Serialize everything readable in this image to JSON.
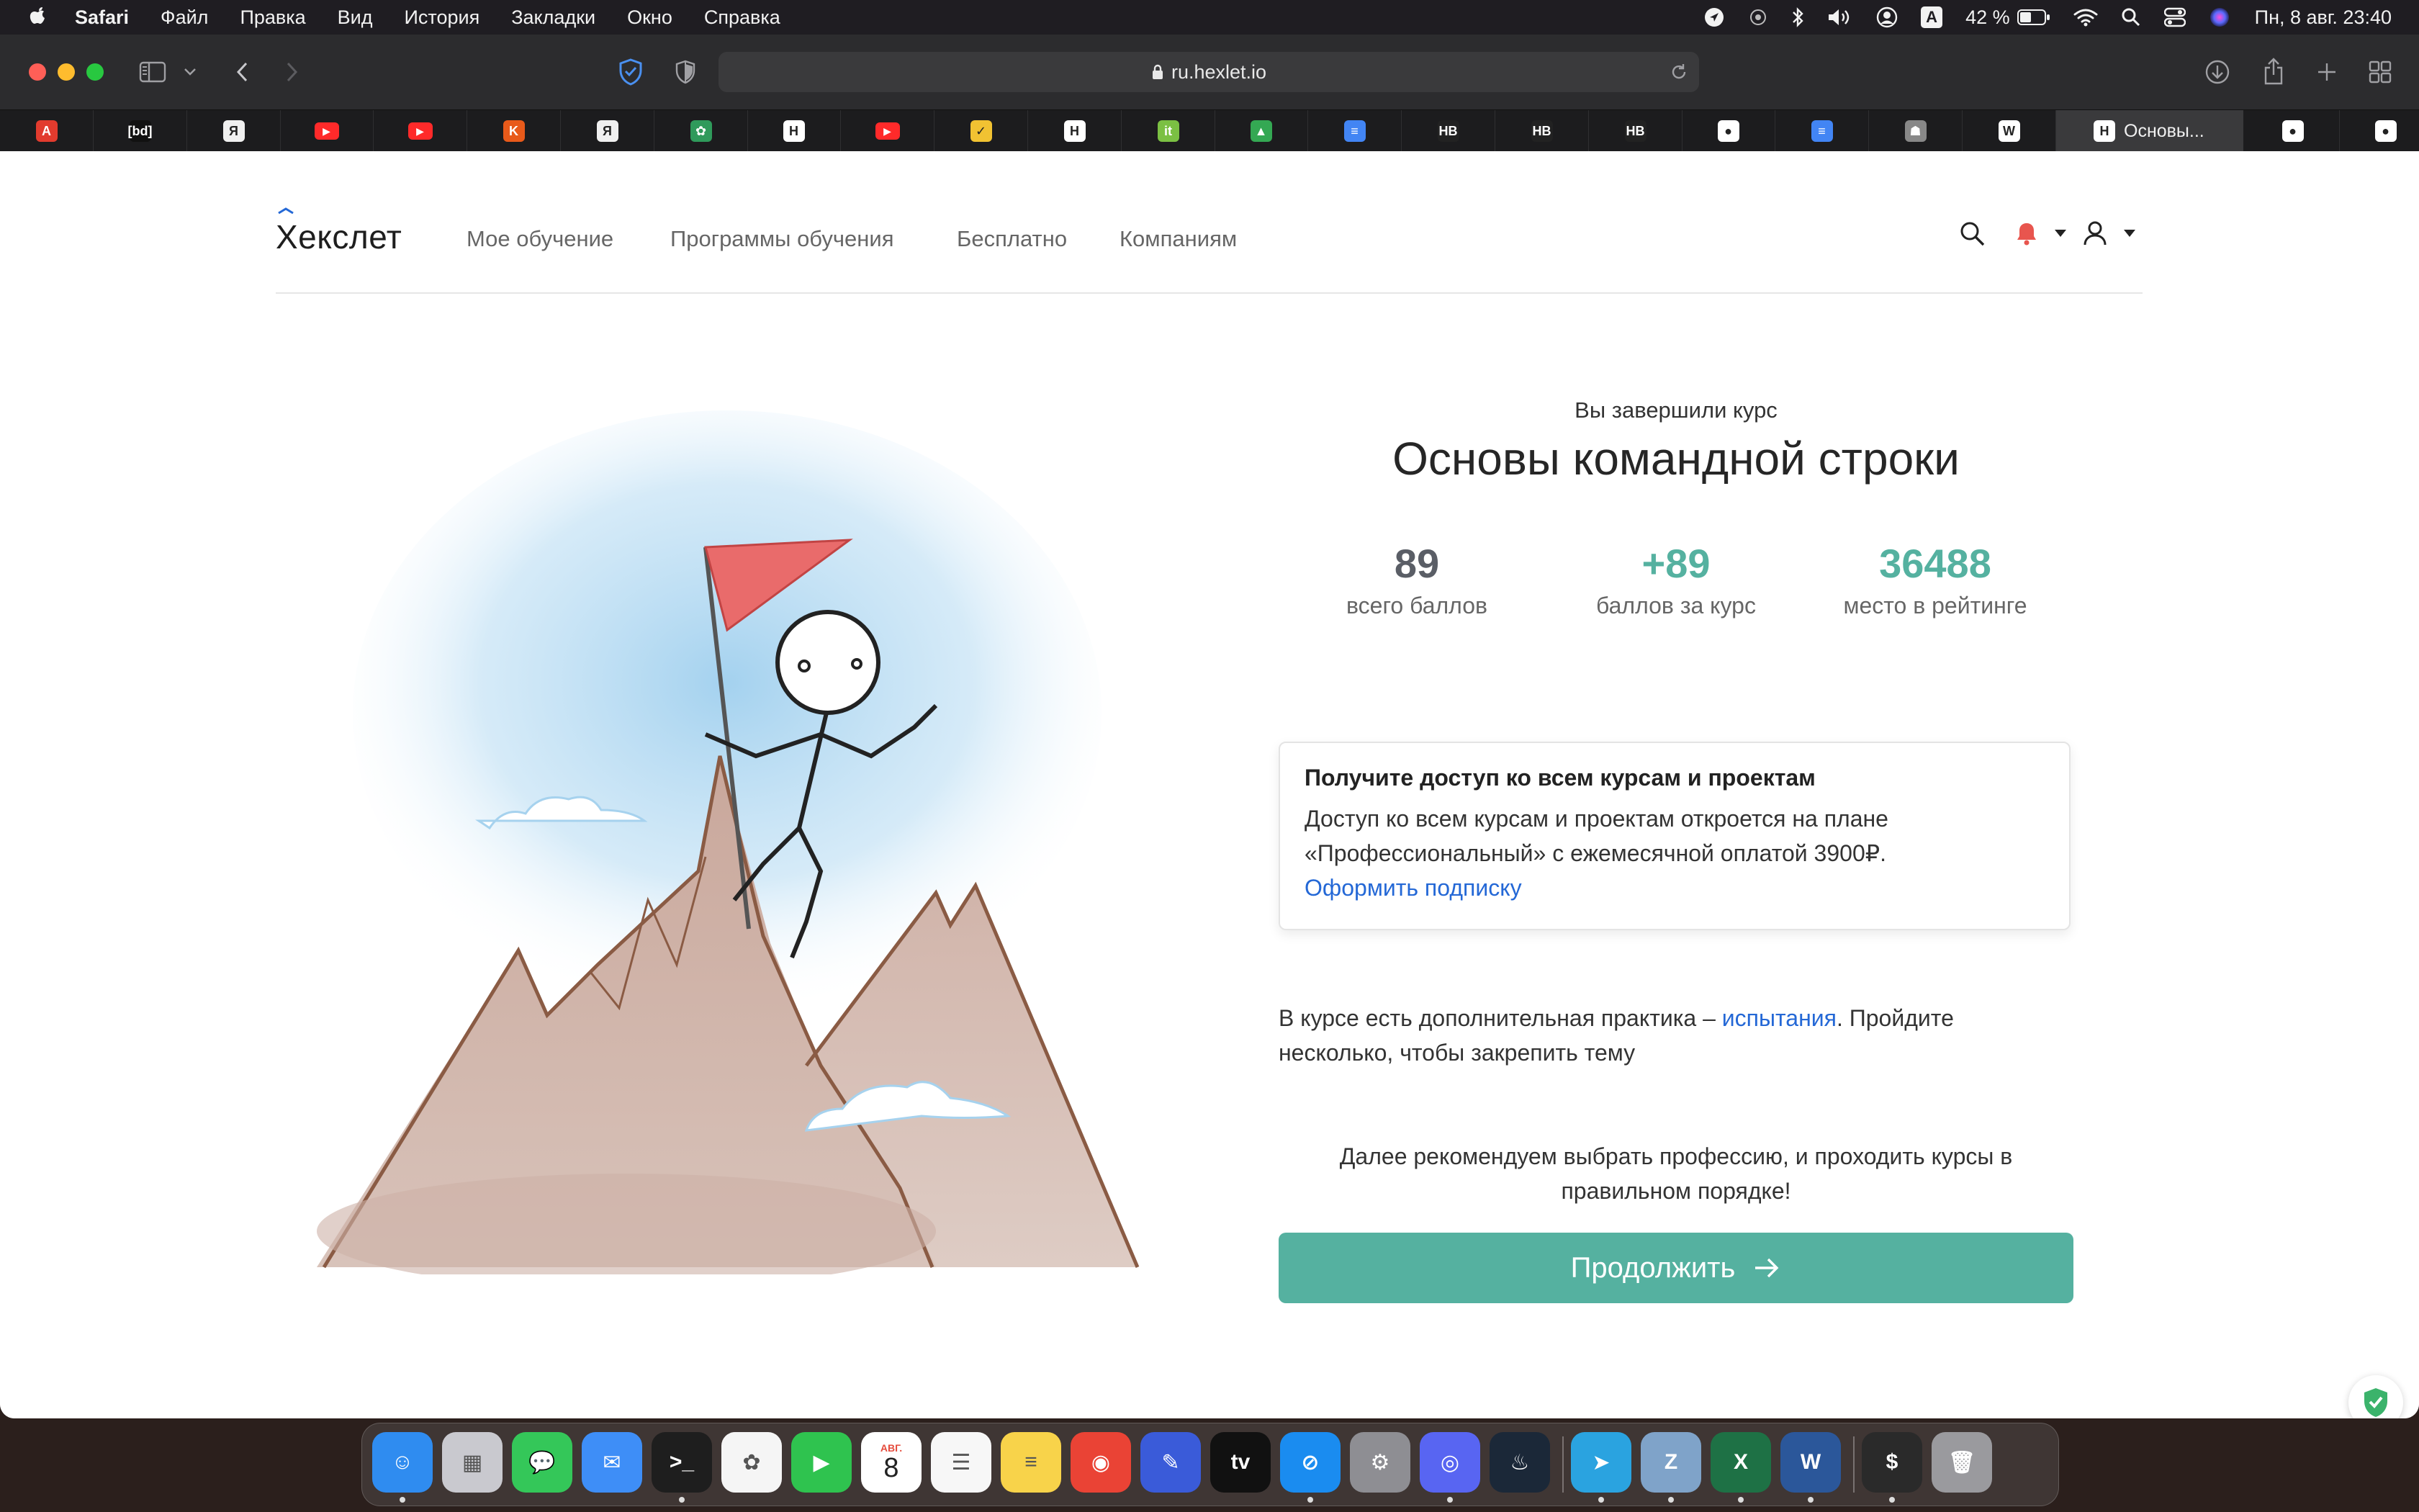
{
  "menubar": {
    "app": "Safari",
    "items": [
      "Файл",
      "Правка",
      "Вид",
      "История",
      "Закладки",
      "Окно",
      "Справка"
    ],
    "input_indicator": "A",
    "battery": "42 %",
    "clock": "Пн, 8 авг.  23:40"
  },
  "browser": {
    "url": "ru.hexlet.io",
    "active_tab": "Основы...",
    "pinned_tabs": [
      {
        "icon": "adobe-acrobat-icon",
        "glyph": "A",
        "color": "#e23b2e"
      },
      {
        "icon": "bd-icon",
        "glyph": "[bd]",
        "color": "#111111"
      },
      {
        "icon": "yandex-icon",
        "glyph": "Я",
        "color": "#f0f0f0"
      },
      {
        "icon": "youtube-icon",
        "glyph": "▶",
        "color": "#ff2a2a"
      },
      {
        "icon": "youtube-icon",
        "glyph": "▶",
        "color": "#ff2a2a"
      },
      {
        "icon": "kinopoisk-icon",
        "glyph": "K",
        "color": "#e85a1a"
      },
      {
        "icon": "yandex-icon",
        "glyph": "Я",
        "color": "#f0f0f0"
      },
      {
        "icon": "leaf-icon",
        "glyph": "✿",
        "color": "#2f9a5b"
      },
      {
        "icon": "hexlet-icon",
        "glyph": "H",
        "color": "#ffffff"
      },
      {
        "icon": "youtube-icon",
        "glyph": "▶",
        "color": "#ff2a2a"
      },
      {
        "icon": "checkbox-icon",
        "glyph": "✓",
        "color": "#f1c232"
      },
      {
        "icon": "hexlet-icon",
        "glyph": "H",
        "color": "#ffffff"
      },
      {
        "icon": "it-icon",
        "glyph": "it",
        "color": "#7bc043"
      },
      {
        "icon": "google-drive-icon",
        "glyph": "▲",
        "color": "#34a853"
      },
      {
        "icon": "google-docs-icon",
        "glyph": "≡",
        "color": "#4285f4"
      },
      {
        "icon": "hb-icon",
        "glyph": "HB",
        "color": "#222222"
      },
      {
        "icon": "hb-icon",
        "glyph": "HB",
        "color": "#222222"
      },
      {
        "icon": "hb-icon",
        "glyph": "HB",
        "color": "#222222"
      },
      {
        "icon": "github-icon",
        "glyph": "●",
        "color": "#ffffff"
      },
      {
        "icon": "google-docs-icon",
        "glyph": "≡",
        "color": "#4285f4"
      },
      {
        "icon": "robot-icon",
        "glyph": "☗",
        "color": "#888888"
      },
      {
        "icon": "wikipedia-icon",
        "glyph": "W",
        "color": "#ffffff"
      }
    ],
    "trailing_tabs": [
      {
        "icon": "github-icon",
        "glyph": "●",
        "color": "#ffffff"
      },
      {
        "icon": "github-icon",
        "glyph": "●",
        "color": "#ffffff"
      },
      {
        "icon": "github-icon",
        "glyph": "●",
        "color": "#ffffff"
      }
    ]
  },
  "site": {
    "logo": "Хекслет",
    "nav": [
      "Мое обучение",
      "Программы обучения",
      "Бесплатно",
      "Компаниям"
    ]
  },
  "completion": {
    "label": "Вы завершили курс",
    "course_title": "Основы командной строки",
    "stats": [
      {
        "value": "89",
        "label": "всего баллов",
        "color": "#5a5e66"
      },
      {
        "value": "+89",
        "label": "баллов за курс",
        "color": "#55b1a0"
      },
      {
        "value": "36488",
        "label": "место в рейтинге",
        "color": "#55b1a0"
      }
    ],
    "promo": {
      "title": "Получите доступ ко всем курсам и проектам",
      "text": "Доступ ко всем курсам и проектам откроется на плане «Профессиональный» с ежемесячной оплатой 3900₽.",
      "link": "Оформить подписку"
    },
    "practice": {
      "before": "В курсе есть дополнительная практика – ",
      "link": "испытания",
      "after": ". Пройдите несколько, чтобы закрепить тему"
    },
    "next_step": "Далее рекомендуем выбрать профессию, и проходить курсы в правильном порядке!",
    "continue_label": "Продолжить"
  },
  "dock": {
    "calendar_month": "АВГ.",
    "calendar_day": "8",
    "apps": [
      {
        "name": "finder-icon",
        "glyph": "☺",
        "color": "#2f8cf0"
      },
      {
        "name": "launchpad-icon",
        "glyph": "▦",
        "color": "#c9c9cf"
      },
      {
        "name": "messages-icon",
        "glyph": "💬",
        "color": "#34c759"
      },
      {
        "name": "mail-icon",
        "glyph": "✉",
        "color": "#3e8ef7"
      },
      {
        "name": "terminal-icon",
        "glyph": ">_",
        "color": "#1e1e1e"
      },
      {
        "name": "photos-icon",
        "glyph": "✿",
        "color": "#f5f5f5"
      },
      {
        "name": "facetime-icon",
        "glyph": "▶",
        "color": "#2fc34f"
      },
      {
        "name": "calendar-icon",
        "glyph": "",
        "color": "#ffffff"
      },
      {
        "name": "reminders-icon",
        "glyph": "☰",
        "color": "#f7f7f7"
      },
      {
        "name": "notes-icon",
        "glyph": "≡",
        "color": "#f8d34a"
      },
      {
        "name": "chrome-icon",
        "glyph": "◉",
        "color": "#ea4335"
      },
      {
        "name": "pencil-app-icon",
        "glyph": "✎",
        "color": "#3a5bd9"
      },
      {
        "name": "apple-tv-icon",
        "glyph": "tv",
        "color": "#111111"
      },
      {
        "name": "safari-icon",
        "glyph": "⊘",
        "color": "#1a8cf0"
      },
      {
        "name": "system-preferences-icon",
        "glyph": "⚙",
        "color": "#8e8e93"
      },
      {
        "name": "discord-icon",
        "glyph": "◎",
        "color": "#5865f2"
      },
      {
        "name": "steam-icon",
        "glyph": "♨",
        "color": "#1b2838"
      },
      {
        "name": "telegram-icon",
        "glyph": "➤",
        "color": "#2aa3e0"
      },
      {
        "name": "archive-utility-icon",
        "glyph": "Z",
        "color": "#7fa3c9"
      },
      {
        "name": "excel-icon",
        "glyph": "X",
        "color": "#1e7145"
      },
      {
        "name": "word-icon",
        "glyph": "W",
        "color": "#2b579a"
      },
      {
        "name": "terminal-window-icon",
        "glyph": "$",
        "color": "#2a2a2a"
      },
      {
        "name": "trash-icon",
        "glyph": "🗑",
        "color": "#9a9a9e"
      }
    ]
  }
}
